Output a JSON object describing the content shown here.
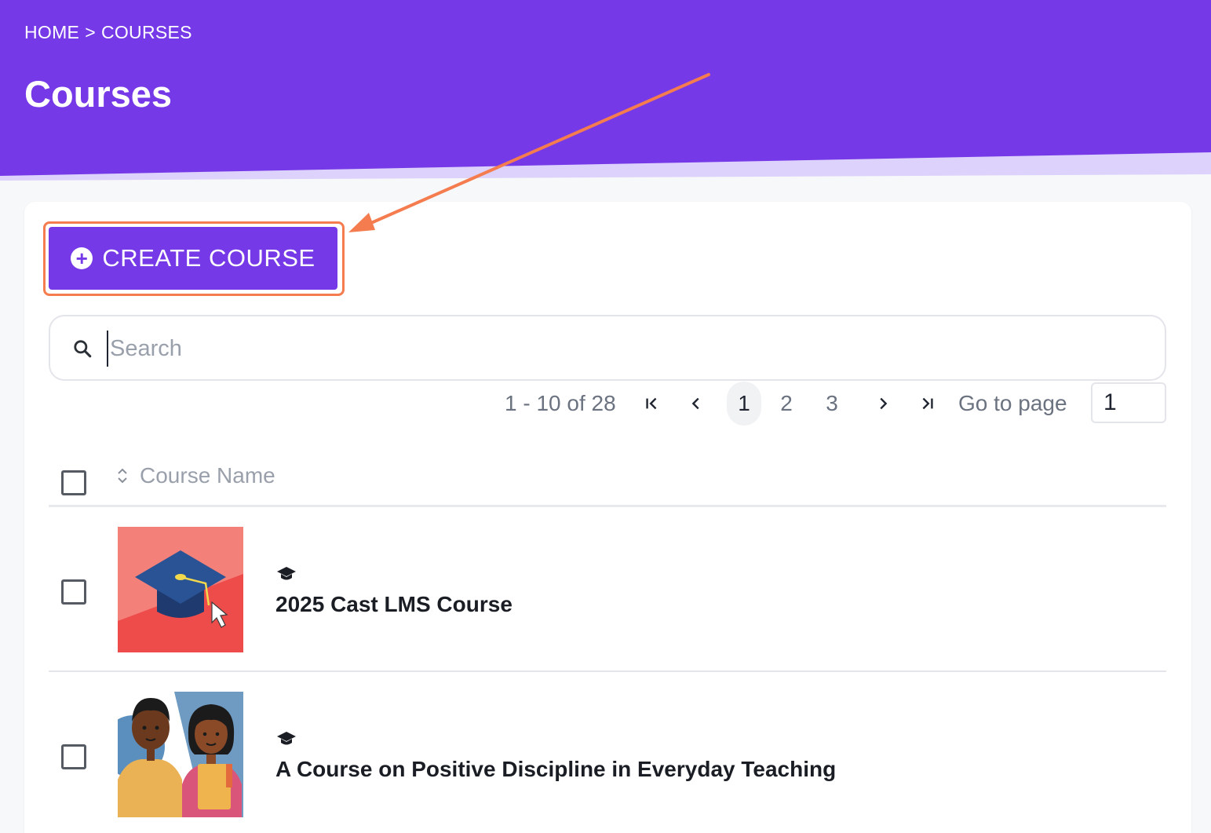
{
  "breadcrumb": {
    "home": "HOME",
    "separator": ">",
    "current": "COURSES"
  },
  "page": {
    "title": "Courses"
  },
  "toolbar": {
    "create_label": "CREATE COURSE",
    "create_icon": "plus-circle-icon"
  },
  "search": {
    "placeholder": "Search",
    "value": "",
    "icon": "search-icon"
  },
  "pagination": {
    "range": "1 - 10 of 28",
    "pages": [
      "1",
      "2",
      "3"
    ],
    "current_page": "1",
    "goto_label": "Go to page",
    "goto_value": "1"
  },
  "table": {
    "header": {
      "course_name": "Course Name"
    },
    "rows": [
      {
        "name": "2025 Cast LMS Course",
        "icon": "graduation-cap-icon"
      },
      {
        "name": "A Course on Positive Discipline in Everyday Teaching",
        "icon": "graduation-cap-icon"
      }
    ]
  },
  "colors": {
    "brand": "#7639e8",
    "header_band": "#7639e8",
    "header_band_light": "#ddd2fb",
    "highlight": "#f47c4e"
  }
}
